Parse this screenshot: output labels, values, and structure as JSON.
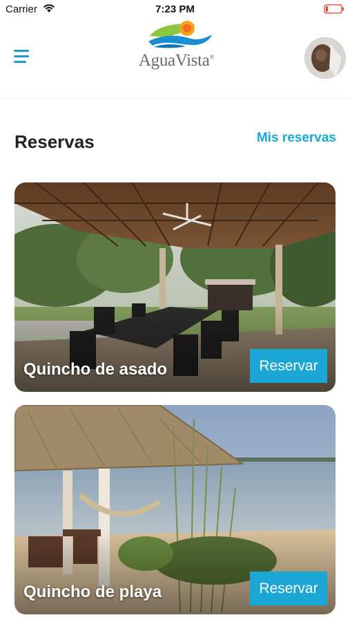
{
  "status_bar": {
    "carrier": "Carrier",
    "time": "7:23 PM",
    "wifi_icon": "wifi-icon",
    "battery_icon": "battery-low-icon"
  },
  "header": {
    "menu_icon": "hamburger-menu-icon",
    "logo_text": "AguaVista",
    "logo_mark": "®",
    "avatar": "user-avatar"
  },
  "section": {
    "title": "Reservas",
    "link_label": "Mis reservas"
  },
  "cards": [
    {
      "title": "Quincho de asado",
      "button_label": "Reservar"
    },
    {
      "title": "Quincho de playa",
      "button_label": "Reservar"
    }
  ],
  "colors": {
    "accent": "#1ba6d6",
    "link": "#19a8d6",
    "menu": "#1a98d5",
    "title_text": "#222222",
    "logo_text": "#6b6b6b",
    "battery_low": "#e53935"
  }
}
